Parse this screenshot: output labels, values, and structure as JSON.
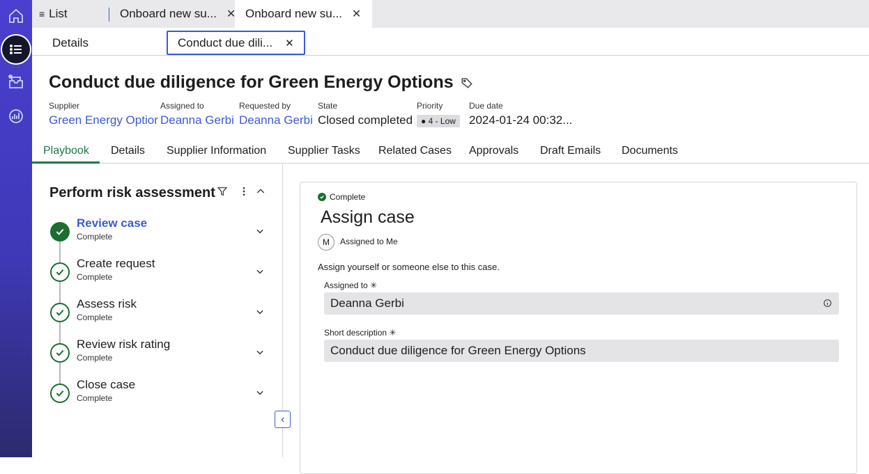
{
  "rail": {
    "items": [
      {
        "icon": "home-icon"
      },
      {
        "icon": "list-icon"
      },
      {
        "icon": "inbox-icon"
      },
      {
        "icon": "analytics-icon"
      }
    ]
  },
  "tabs": {
    "list_label": "List",
    "tab1": "Onboard new su...",
    "tab2": "Onboard new su..."
  },
  "subtabs": {
    "details": "Details",
    "active": "Conduct due dili..."
  },
  "record": {
    "title": "Conduct due diligence for Green Energy Options",
    "supplier_label": "Supplier",
    "supplier": "Green Energy Optior",
    "assigned_label": "Assigned to",
    "assigned": "Deanna Gerbi",
    "requested_label": "Requested by",
    "requested": "Deanna Gerbi",
    "state_label": "State",
    "state": "Closed completed",
    "priority_label": "Priority",
    "priority": "4 - Low",
    "due_label": "Due date",
    "due": "2024-01-24 00:32..."
  },
  "navtabs": [
    "Playbook",
    "Details",
    "Supplier Information",
    "Supplier Tasks",
    "Related Cases",
    "Approvals",
    "Draft Emails",
    "Documents"
  ],
  "playbook": {
    "title": "Perform risk assessment",
    "steps": [
      {
        "name": "Review case",
        "status": "Complete"
      },
      {
        "name": "Create request",
        "status": "Complete"
      },
      {
        "name": "Assess risk",
        "status": "Complete"
      },
      {
        "name": "Review risk rating",
        "status": "Complete"
      },
      {
        "name": "Close case",
        "status": "Complete"
      }
    ]
  },
  "card": {
    "status": "Complete",
    "title": "Assign case",
    "avatar": "M",
    "assigned_me": "Assigned to Me",
    "instruction": "Assign yourself or someone else to this case.",
    "assigned_label": "Assigned to ✳",
    "assigned_value": "Deanna Gerbi",
    "short_label": "Short description ✳",
    "short_value": "Conduct due diligence for Green Energy Options"
  },
  "colors": {
    "rail": "#4a3fd0",
    "accent": "#3b5bd6",
    "green": "#1b6e2f"
  }
}
